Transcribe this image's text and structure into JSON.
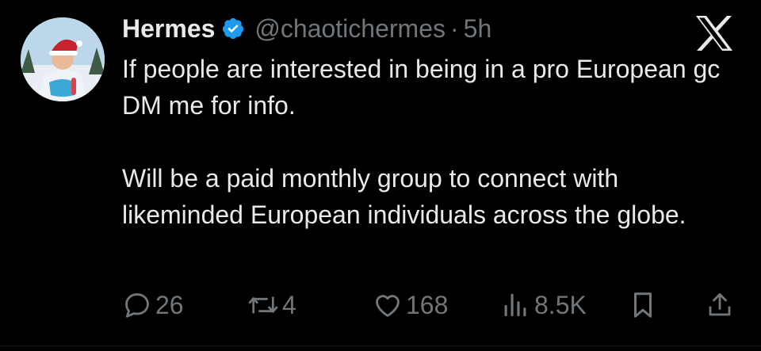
{
  "tweet": {
    "author_name": "Hermes",
    "handle": "@chaotichermes",
    "separator": "·",
    "time": "5h",
    "verified": true,
    "avatar_icon": "profile-photo-santa-hat",
    "platform_icon": "x-logo-icon",
    "paragraphs": [
      "If people are interested in being in a pro European gc DM me for info.",
      "Will be a paid monthly group to connect with likeminded European individuals across the globe."
    ]
  },
  "actions": {
    "replies": "26",
    "retweets": "4",
    "likes": "168",
    "views": "8.5K"
  },
  "colors": {
    "background": "#000000",
    "text": "#e7e9ea",
    "muted": "#71767b",
    "verified": "#1d9bf0"
  }
}
